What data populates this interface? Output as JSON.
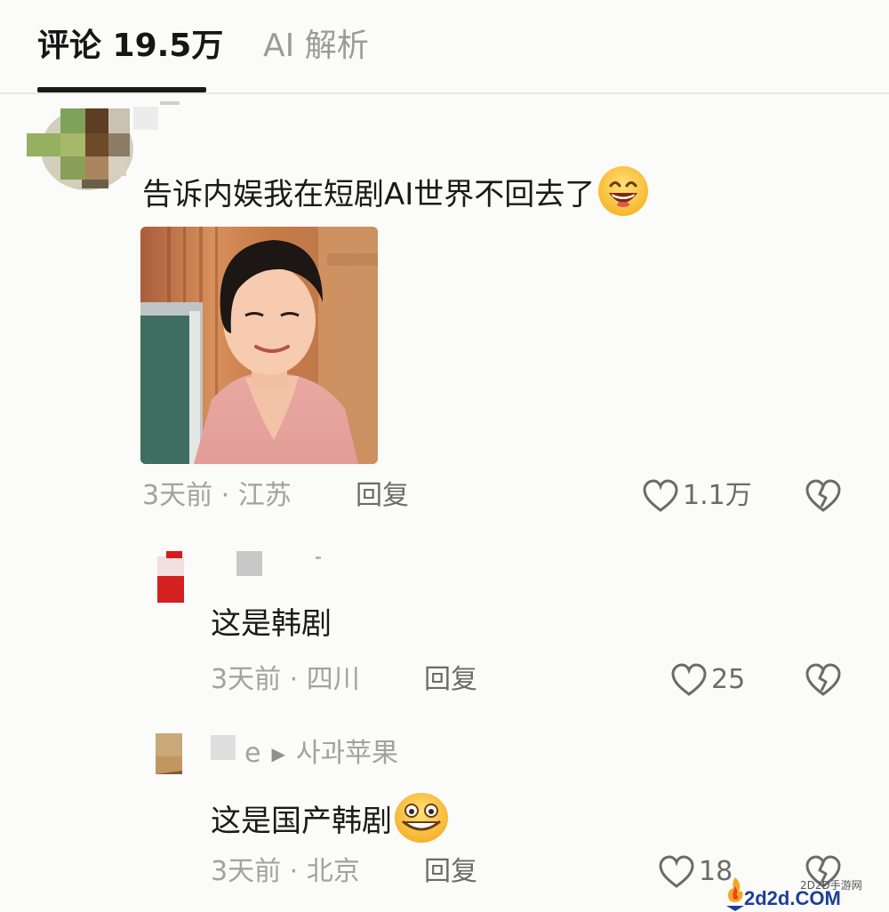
{
  "tabs": {
    "comments_label": "评论 19.5万",
    "ai_label": "AI 解析"
  },
  "main_comment": {
    "text": "告诉内娱我在短剧AI世界不回去了",
    "emoji": "grin-emoji",
    "time": "3天前",
    "location": "江苏",
    "reply_label": "回复",
    "likes": "1.1万"
  },
  "replies": [
    {
      "text": "这是韩剧",
      "time": "3天前",
      "location": "四川",
      "reply_label": "回复",
      "likes": "25"
    },
    {
      "reply_to_arrow": "▶",
      "reply_to": "사과苹果",
      "name_partial": "e",
      "text": "这是国产韩剧",
      "emoji": "silly-emoji",
      "time": "3天前",
      "location": "北京",
      "reply_label": "回复",
      "likes": "18"
    }
  ],
  "watermark": {
    "small": "2D2D手游网",
    "big": "2d2d.COM"
  },
  "colors": {
    "background": "#fbfbf9",
    "meta_gray": "#a2a2a2",
    "active_tab_underline": "#1a1a1a",
    "watermark_blue": "#1d3e9a"
  }
}
